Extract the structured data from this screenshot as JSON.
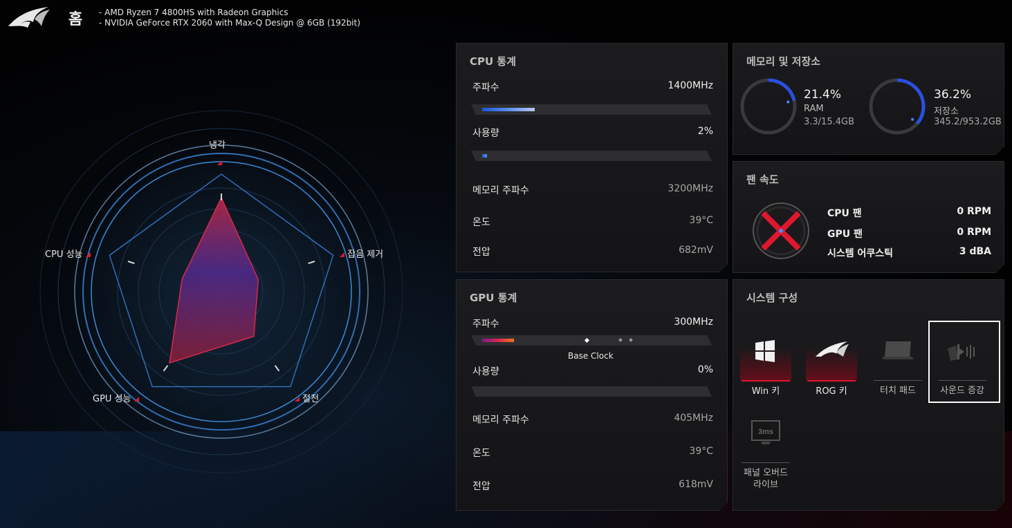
{
  "header": {
    "title": "홈",
    "cpu_info": "AMD Ryzen 7 4800HS with Radeon Graphics",
    "gpu_info": "NVIDIA GeForce RTX 2060 with Max-Q Design @ 6GB (192bit)"
  },
  "radar": {
    "labels": {
      "cooling": "냉각",
      "noise": "잡음 제거",
      "power_saving": "절전",
      "gpu": "GPU 성능",
      "cpu": "CPU 성능"
    },
    "levels": {
      "cooling": 0.8,
      "noise": 0.33,
      "power_saving": 0.47,
      "gpu": 0.75,
      "cpu": 0.35
    },
    "colors": {
      "accent_red": "#e0182d",
      "accent_blue": "#2e7fd8"
    }
  },
  "cpu_stats": {
    "title": "CPU 통계",
    "freq_label": "주파수",
    "freq_value": "1400MHz",
    "freq_level": 0.23,
    "usage_label": "사용량",
    "usage_value": "2%",
    "usage_level": 0.02,
    "mem_freq_label": "메모리 주파수",
    "mem_freq_value": "3200MHz",
    "temp_label": "온도",
    "temp_value": "39°C",
    "voltage_label": "전압",
    "voltage_value": "682mV"
  },
  "gpu_stats": {
    "title": "GPU 통계",
    "freq_label": "주파수",
    "freq_value": "300MHz",
    "freq_level": 0.14,
    "base_clock_label": "Base Clock",
    "usage_label": "사용량",
    "usage_value": "0%",
    "usage_level": 0,
    "mem_freq_label": "메모리 주파수",
    "mem_freq_value": "405MHz",
    "temp_label": "온도",
    "temp_value": "39°C",
    "voltage_label": "전압",
    "voltage_value": "618mV"
  },
  "memory_storage": {
    "title": "메모리 및 저장소",
    "ram_pct": "21.4%",
    "ram_label": "RAM",
    "ram_detail": "3.3/15.4GB",
    "ram_level": 0.214,
    "storage_pct": "36.2%",
    "storage_label": "저장소",
    "storage_detail": "345.2/953.2GB",
    "storage_level": 0.362
  },
  "fan_speed": {
    "title": "팬 속도",
    "rows": [
      {
        "label": "CPU 팬",
        "value": "0 RPM"
      },
      {
        "label": "GPU 팬",
        "value": "0 RPM"
      },
      {
        "label": "시스템 어쿠스틱",
        "value": "3 dBA"
      }
    ]
  },
  "system_config": {
    "title": "시스템 구성",
    "items": [
      {
        "label": "Win 키",
        "icon": "windows-icon",
        "enabled": true
      },
      {
        "label": "ROG 키",
        "icon": "rog-icon",
        "enabled": true
      },
      {
        "label": "터치 패드",
        "icon": "touchpad-icon",
        "enabled": false
      },
      {
        "label": "사운드 증강",
        "icon": "sound-boost-icon",
        "enabled": false
      },
      {
        "label": "패널 오버드\n라이브",
        "icon": "panel-overdrive-icon",
        "enabled": false
      }
    ],
    "panel_overdrive_icon_text": "3ms"
  }
}
